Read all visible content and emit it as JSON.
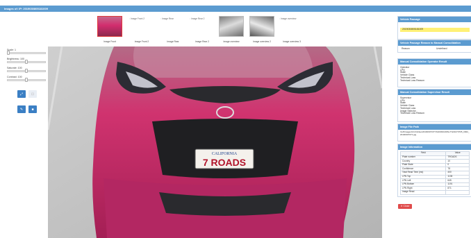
{
  "window": {
    "title": "Images of: IP: 2019030805181009"
  },
  "thumbnails": [
    {
      "caption": "Image Front",
      "broken": false,
      "kind": "car"
    },
    {
      "caption": "Image Front 2",
      "broken": true,
      "alt": "Image Front 2",
      "kind": ""
    },
    {
      "caption": "Image Rear",
      "broken": true,
      "alt": "Image Rear",
      "kind": ""
    },
    {
      "caption": "Image Rear 2",
      "broken": true,
      "alt": "Image Rear 2",
      "kind": ""
    },
    {
      "caption": "Image overview",
      "broken": false,
      "kind": "ov1"
    },
    {
      "caption": "Image overview 2",
      "broken": false,
      "kind": "ov2"
    },
    {
      "caption": "Image overview 3",
      "broken": true,
      "alt": "Image overview",
      "kind": ""
    }
  ],
  "controls": {
    "scale": {
      "label": "Scale: 1",
      "level": 0.04
    },
    "brightness": {
      "label": "Brightness: 100",
      "level": 0.5
    },
    "saturate": {
      "label": "Saturate: 100",
      "level": 0.5
    },
    "contrast": {
      "label": "Contrast: 100",
      "level": 0.5
    }
  },
  "main_image": {
    "plate_top": "CALIFORNIA",
    "plate_text": "7 ROADS"
  },
  "panels": {
    "vehicle_passage": {
      "title": "Vehicle Passage",
      "value": "2019030805181009"
    },
    "manual_consolidation": {
      "title": "Vehicle Passage Reason to Manual Consolidation",
      "label": "Reason",
      "value": "Undefined"
    },
    "operator_result": {
      "title": "Manual Consolidation Operator Result",
      "lines": [
        "Operator",
        "LPN",
        "State",
        "Vehicle Class",
        "Technical Loss",
        "Technical Loss Reason"
      ]
    },
    "supervisor_result": {
      "title": "Manual Consolidation Supervisor Result",
      "lines": [
        "Supervisor",
        "LPN",
        "State",
        "Vehicle Class",
        "Technical Loss",
        "Image Selector",
        "Technical Loss Reason"
      ]
    },
    "file_path": {
      "title": "Image File Path",
      "value": "\\\\LZIImages\\VLG\\Video\\20190307\\07\\TG0003\\1000\\L\\TG01070705_0002_20190307071.jpg"
    },
    "image_info": {
      "title": "Image Information",
      "headers": [
        "Field",
        "Value"
      ],
      "rows": [
        [
          "Plate number",
          "7ROADS"
        ],
        [
          "Country",
          "10"
        ],
        [
          "Plate State",
          "0"
        ],
        [
          "Confidence",
          "78"
        ],
        [
          "Total Read Time (ms)",
          "400"
        ],
        [
          "LPN Top",
          "1135"
        ],
        [
          "LPN Left",
          "645"
        ],
        [
          "LPN Bottom",
          "1191"
        ],
        [
          "LPN Right",
          "871"
        ],
        [
          "Image Read",
          ""
        ]
      ]
    }
  },
  "close_label": "Close",
  "colors": {
    "header": "#5b9bd0",
    "highlight": "#fff176",
    "close": "#e04b4b",
    "car": "#d22d6e"
  }
}
